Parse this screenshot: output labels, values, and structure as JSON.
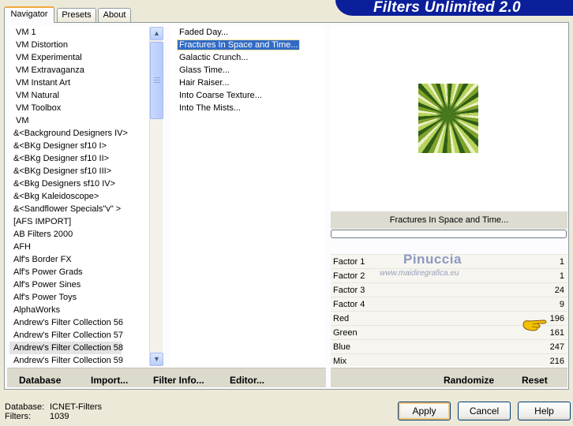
{
  "header": {
    "title": "Filters Unlimited 2.0"
  },
  "tabs": [
    {
      "label": "Navigator",
      "active": true
    },
    {
      "label": "Presets",
      "active": false
    },
    {
      "label": "About",
      "active": false
    }
  ],
  "categories": [
    "VM 1",
    "VM Distortion",
    "VM Experimental",
    "VM Extravaganza",
    "VM Instant Art",
    "VM Natural",
    "VM Toolbox",
    "VM",
    "&<Background Designers IV>",
    "&<BKg Designer sf10 I>",
    "&<BKg Designer sf10 II>",
    "&<BKg Designer sf10 III>",
    "&<Bkg Designers sf10 IV>",
    "&<Bkg Kaleidoscope>",
    "&<Sandflower Specials\"v\" >",
    "[AFS IMPORT]",
    "AB Filters 2000",
    "AFH",
    "Alf's Border FX",
    "Alf's Power Grads",
    "Alf's Power Sines",
    "Alf's Power Toys",
    "AlphaWorks",
    "Andrew's Filter Collection 56",
    "Andrew's Filter Collection 57",
    "Andrew's Filter Collection 58",
    "Andrew's Filter Collection 59"
  ],
  "selected_category": "Andrew's Filter Collection 58",
  "filters": [
    "Faded Day...",
    "Fractures In Space and Time...",
    "Galactic Crunch...",
    "Glass Time...",
    "Hair Raiser...",
    "Into Coarse Texture...",
    "Into The Mists..."
  ],
  "selected_filter": "Fractures In Space and Time...",
  "preview": {
    "filter_name": "Fractures In Space and Time..."
  },
  "params": [
    {
      "label": "Factor 1",
      "value": "1"
    },
    {
      "label": "Factor 2",
      "value": "1"
    },
    {
      "label": "Factor 3",
      "value": "24"
    },
    {
      "label": "Factor 4",
      "value": "9"
    },
    {
      "label": "Red",
      "value": "196"
    },
    {
      "label": "Green",
      "value": "161"
    },
    {
      "label": "Blue",
      "value": "247"
    },
    {
      "label": "Mix",
      "value": "216"
    }
  ],
  "watermark": {
    "name": "Pinuccia",
    "url": "www.maidiregrafica.eu"
  },
  "actions": {
    "database": "Database",
    "import": "Import...",
    "filter_info": "Filter Info...",
    "editor": "Editor...",
    "randomize": "Randomize",
    "reset": "Reset"
  },
  "footer": {
    "database_label": "Database:",
    "database_value": "ICNET-Filters",
    "filters_label": "Filters:",
    "filters_value": "1039"
  },
  "buttons": {
    "apply": "Apply",
    "cancel": "Cancel",
    "help": "Help"
  }
}
